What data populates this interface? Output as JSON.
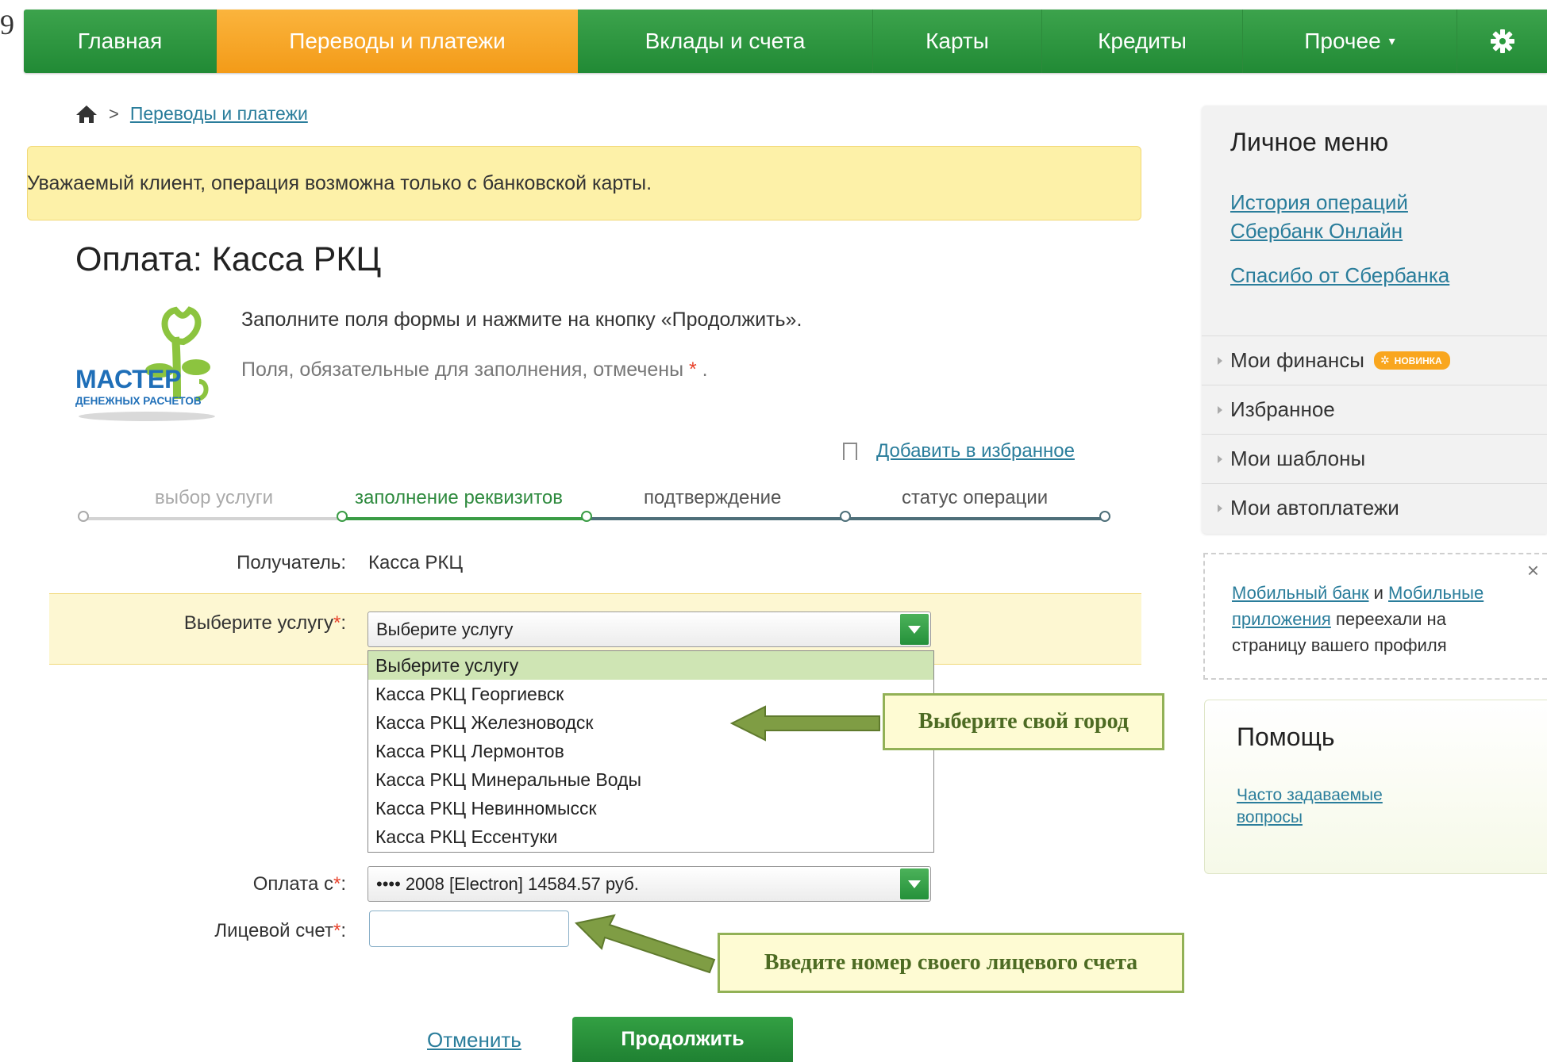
{
  "corner_text": "9",
  "nav": {
    "items": [
      {
        "label": "Главная"
      },
      {
        "label": "Переводы и платежи"
      },
      {
        "label": "Вклады и счета"
      },
      {
        "label": "Карты"
      },
      {
        "label": "Кредиты"
      },
      {
        "label": "Прочее"
      }
    ],
    "active": "Переводы и платежи",
    "settings_icon": "gear-icon",
    "accent_green": "#2a9a3e",
    "accent_orange": "#f7a628"
  },
  "breadcrumb": {
    "home_icon": "home-icon",
    "link": "Переводы и платежи"
  },
  "notice": "Уважаемый клиент, операция возможна только с банковской карты.",
  "page_title": "Оплата: Касса РКЦ",
  "logo": {
    "line1": "МАСТЕР",
    "line2": "ДЕНЕЖНЫХ РАСЧЕТОВ"
  },
  "info": {
    "line1": "Заполните поля формы и нажмите на кнопку «Продолжить».",
    "line2": "Поля, обязательные для заполнения, отмечены",
    "req_mark": "*",
    "line2_end": "."
  },
  "favorites": "Добавить в избранное",
  "steps": [
    {
      "label": "выбор услуги",
      "state": "done"
    },
    {
      "label": "заполнение реквизитов",
      "state": "current"
    },
    {
      "label": "подтверждение",
      "state": "future"
    },
    {
      "label": "статус операции",
      "state": "future"
    }
  ],
  "form": {
    "recipient_label": "Получатель:",
    "recipient_value": "Касса РКЦ",
    "service_label": "Выберите услугу",
    "service_value": "Выберите услугу",
    "service_options": [
      "Выберите услугу",
      "Касса РКЦ Георгиевск",
      "Касса РКЦ Железноводск",
      "Касса РКЦ Лермонтов",
      "Касса РКЦ Минеральные Воды",
      "Касса РКЦ Невинномысск",
      "Касса РКЦ Ессентуки"
    ],
    "pay_from_label": "Оплата с",
    "pay_from_value": "•••• 2008 [Electron] 14584.57 руб.",
    "account_label": "Лицевой счет",
    "account_value": "",
    "required_mark": "*",
    "colon": ":"
  },
  "buttons": {
    "cancel": "Отменить",
    "continue": "Продолжить"
  },
  "callouts": {
    "city": "Выберите свой город",
    "account": "Введите номер своего лицевого счета"
  },
  "sidebar": {
    "title": "Личное меню",
    "link1_a": "История операций",
    "link1_b": "Сбербанк Онлайн",
    "link2": "Спасибо от Сбербанка",
    "items": [
      {
        "label": "Мои финансы",
        "badge": "НОВИНКА"
      },
      {
        "label": "Избранное"
      },
      {
        "label": "Мои шаблоны"
      },
      {
        "label": "Мои автоплатежи"
      }
    ],
    "mobile": {
      "link1": "Мобильный банк",
      "and": "и",
      "link2a": "Мобильные",
      "link2b": "приложения",
      "rest1": "переехали на",
      "rest2": "страницу вашего профиля",
      "close": "×"
    },
    "help": {
      "title": "Помощь",
      "link_a": "Часто задаваемые",
      "link_b": "вопросы"
    }
  }
}
